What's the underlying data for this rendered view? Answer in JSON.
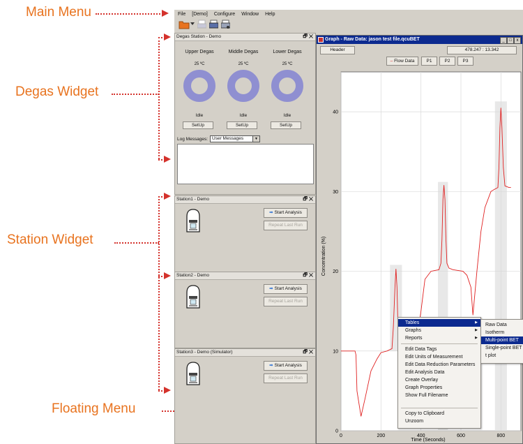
{
  "callouts": {
    "main_menu": "Main Menu",
    "degas_widget": "Degas Widget",
    "station_widget": "Station Widget",
    "floating_menu": "Floating Menu"
  },
  "menubar": [
    "File",
    "[Demo]",
    "Configure",
    "Window",
    "Help"
  ],
  "degas": {
    "title": "Degas Station - Demo",
    "controls": "🗗 ✕",
    "columns": [
      {
        "name": "Upper Degas",
        "temp": "25 ºC",
        "status": "Idle",
        "button": "SetUp"
      },
      {
        "name": "Middle Degas",
        "temp": "25 ºC",
        "status": "Idle",
        "button": "SetUp"
      },
      {
        "name": "Lower Degas",
        "temp": "25 ºC",
        "status": "Idle",
        "button": "SetUp"
      }
    ],
    "log_label": "Log Messages:",
    "log_select": "User Messages",
    "ring_color": "#8f8fd1"
  },
  "stations": [
    {
      "title": "Station1 - Demo",
      "start": "Start Analysis",
      "repeat": "Repeat Last Run"
    },
    {
      "title": "Station2 - Demo",
      "start": "Start Analysis",
      "repeat": "Repeat Last Run"
    },
    {
      "title": "Station3 - Demo (Simulator)",
      "start": "Start Analysis",
      "repeat": "Repeat Last Run"
    }
  ],
  "graph": {
    "title": "Graph - Raw Data: jason test file.qcuBET",
    "header_button": "Header",
    "coords": "478.247 : 13.342",
    "legend": [
      "Flow Data",
      "P1",
      "P2",
      "P3"
    ],
    "xlabel": "Time (Seconds)",
    "ylabel": "Concentration (%)",
    "line_color": "#e02020"
  },
  "chart_data": {
    "type": "line",
    "xlabel": "Time (Seconds)",
    "ylabel": "Concentration (%)",
    "xlim": [
      0,
      900
    ],
    "ylim": [
      0,
      45
    ],
    "xticks": [
      0,
      200,
      400,
      600,
      800
    ],
    "yticks": [
      0,
      10,
      20,
      30,
      40
    ],
    "grid": true,
    "series": [
      {
        "name": "Flow Data",
        "x": [
          0,
          40,
          60,
          70,
          75,
          80,
          100,
          120,
          150,
          180,
          200,
          230,
          255,
          262,
          270,
          275,
          280,
          285,
          292,
          300,
          310,
          360,
          380,
          400,
          420,
          450,
          470,
          490,
          500,
          505,
          510,
          515,
          520,
          525,
          530,
          540,
          560,
          610,
          630,
          650,
          660,
          680,
          700,
          720,
          750,
          770,
          785,
          790,
          795,
          800,
          805,
          812,
          820,
          840,
          850
        ],
        "y": [
          10,
          10,
          10,
          10,
          9.5,
          5,
          1.8,
          4,
          7.5,
          9,
          9.8,
          10,
          10.3,
          13,
          18,
          20.3,
          18,
          13,
          10.5,
          10.1,
          10,
          10,
          11.5,
          15,
          19,
          20,
          20.1,
          20.2,
          21,
          24,
          29,
          30.8,
          29,
          24,
          21,
          20.4,
          20.2,
          20,
          19.5,
          18,
          14.5,
          20,
          25,
          28,
          30,
          30.3,
          30.5,
          33,
          38,
          40.5,
          38,
          33,
          30.7,
          30.5,
          30.5
        ]
      }
    ],
    "shaded_regions": [
      {
        "name": "P1",
        "x": [
          245,
          305
        ]
      },
      {
        "name": "P2",
        "x": [
          485,
          535
        ]
      },
      {
        "name": "P3",
        "x": [
          770,
          830
        ]
      }
    ]
  },
  "context_menu": {
    "items": [
      "Tables",
      "Graphs",
      "Reports",
      "Edit Data Tags",
      "Edit Units of Measurement",
      "Edit Data Reduction Parameters",
      "Edit Analysis Data",
      "Create Overlay",
      "Graph Properties",
      "Show Full Filename",
      "Copy to Clipboard",
      "Unzoom"
    ],
    "submenu": [
      "Raw Data",
      "Isotherm",
      "Multi-point BET",
      "Single-point BET",
      "t plot"
    ],
    "highlighted": "Tables",
    "highlighted_sub": "Multi-point BET",
    "highlight_color": "#0c2a8f"
  }
}
